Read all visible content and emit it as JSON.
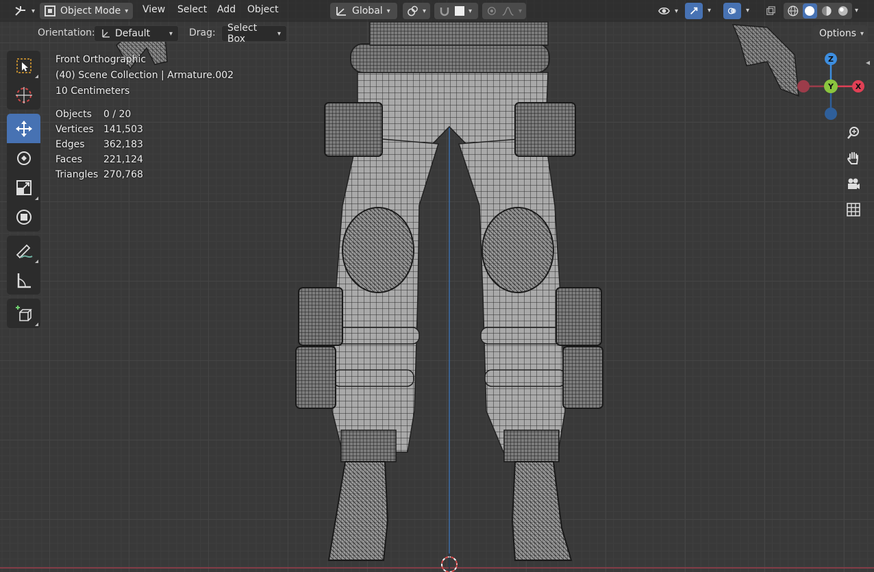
{
  "header": {
    "editor_type_icon": "editor-type-icon",
    "mode": "Object Mode",
    "menus": [
      "View",
      "Select",
      "Add",
      "Object"
    ],
    "transform_orientation": "Global",
    "gizmo_axes": [
      "Z",
      "Y",
      "X"
    ]
  },
  "tool_settings": {
    "orientation_label": "Orientation:",
    "orientation_value": "Default",
    "drag_label": "Drag:",
    "drag_value": "Select Box",
    "options_label": "Options"
  },
  "viewport": {
    "view_name": "Front Orthographic",
    "collection_info": "(40) Scene Collection | Armature.002",
    "grid_scale": "10 Centimeters"
  },
  "stats": [
    {
      "label": "Objects",
      "value": "0 / 20"
    },
    {
      "label": "Vertices",
      "value": "141,503"
    },
    {
      "label": "Edges",
      "value": "362,183"
    },
    {
      "label": "Faces",
      "value": "221,124"
    },
    {
      "label": "Triangles",
      "value": "270,768"
    }
  ],
  "colors": {
    "accent": "#4772b3",
    "axis_x": "#e04055",
    "axis_y": "#8bc53f",
    "axis_z": "#3d8ee0"
  }
}
